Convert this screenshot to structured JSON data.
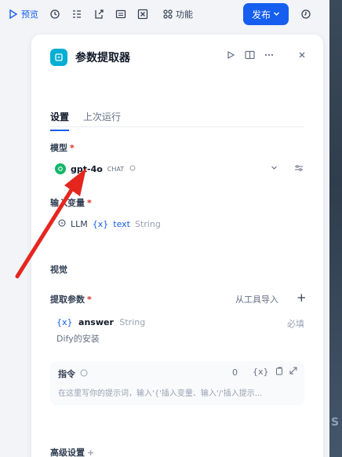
{
  "toolbar": {
    "preview": "预览",
    "features": "功能",
    "publish": "发布"
  },
  "panel": {
    "title": "参数提取器",
    "tabs": [
      "设置",
      "上次运行"
    ],
    "model_label": "模型",
    "model": {
      "name": "gpt-4o",
      "tag": "CHAT"
    },
    "input_label": "输入变量",
    "input_var": {
      "source": "LLM",
      "name": "text",
      "type": "String"
    },
    "vision_label": "视觉",
    "extract_label": "提取参数",
    "import_link": "从工具导入",
    "param": {
      "name": "answer",
      "type": "String",
      "required": "必填",
      "description": "Dify的安装"
    },
    "instruction_label": "指令",
    "instruction_count": "0",
    "instruction_placeholder": "在这里写你的提示词，输入'{'插入变量、输入'/'插入提示...",
    "advanced_label": "高级设置"
  },
  "colors": {
    "accent": "#155eef",
    "required": "#d92d20",
    "arrow": "#e5261f"
  }
}
